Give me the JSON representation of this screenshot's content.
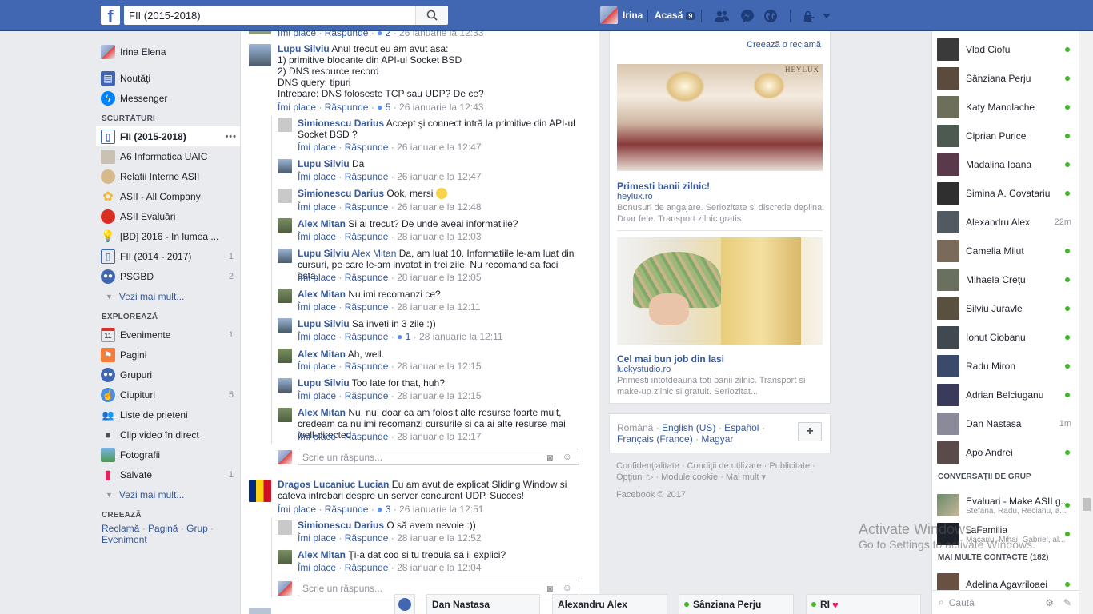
{
  "topbar": {
    "logo": "f",
    "search_value": "FII (2015-2018)",
    "user_name": "Irina",
    "home_label": "Acasă",
    "home_count": "9"
  },
  "left_nav": {
    "profile": "Irina Elena",
    "news": "Noutăţi",
    "messenger": "Messenger",
    "shortcuts_title": "SCURTĂTURI",
    "shortcuts": [
      {
        "label": "FII (2015-2018)",
        "count": ""
      },
      {
        "label": "A6 Informatica UAIC",
        "count": ""
      },
      {
        "label": "Relatii Interne ASII",
        "count": ""
      },
      {
        "label": "ASII - All Company",
        "count": ""
      },
      {
        "label": "ASII Evaluări",
        "count": ""
      },
      {
        "label": "[BD] 2016 - In lumea ...",
        "count": ""
      },
      {
        "label": "FII (2014 - 2017)",
        "count": "1"
      },
      {
        "label": "PSGBD",
        "count": "2"
      }
    ],
    "see_more": "Vezi mai mult...",
    "explore_title": "EXPLOREAZĂ",
    "explore": [
      {
        "label": "Evenimente",
        "count": "1"
      },
      {
        "label": "Pagini",
        "count": ""
      },
      {
        "label": "Grupuri",
        "count": ""
      },
      {
        "label": "Ciupituri",
        "count": "5"
      },
      {
        "label": "Liste de prieteni",
        "count": ""
      },
      {
        "label": "Clip video în direct",
        "count": ""
      },
      {
        "label": "Fotografii",
        "count": ""
      },
      {
        "label": "Salvate",
        "count": "1"
      }
    ],
    "see_more2": "Vezi mai mult...",
    "create_title": "CREEAZĂ",
    "create_links": [
      "Reclamă",
      "Pagină",
      "Grup",
      "Eveniment"
    ],
    "event_day": "11"
  },
  "feed": {
    "like": "Îmi place",
    "reply": "Răspunde",
    "reply_placeholder": "Scrie un răspuns...",
    "top_meta": {
      "count": "2",
      "time": "26 ianuarie la 12:33"
    },
    "comments": [
      {
        "name": "Lupu Silviu",
        "text": "Anul trecut eu am avut asa:\n1) primitive blocante din API-ul Socket BSD\n2) DNS resource record\nDNS query: tipuri\nIntrebare: DNS foloseste TCP sau UDP? De ce?",
        "count": "5",
        "time": "26 ianuarie la 12:43"
      },
      {
        "name": "Simionescu Darius",
        "text": "Accept şi connect intră la primitive din API-ul Socket BSD ?",
        "count": "",
        "time": "26 ianuarie la 12:47"
      },
      {
        "name": "Lupu Silviu",
        "text": "Da",
        "count": "",
        "time": "26 ianuarie la 12:47"
      },
      {
        "name": "Simionescu Darius",
        "text": "Ook, mersi",
        "count": "",
        "time": "26 ianuarie la 12:48"
      },
      {
        "name": "Alex Mitan",
        "text": "Si ai trecut? De unde aveai informatiile?",
        "count": "",
        "time": "28 ianuarie la 12:03"
      },
      {
        "name": "Lupu Silviu",
        "mention": "Alex Mitan",
        "text": "Da, am luat 10. Informatiile le-am luat din cursuri, pe care le-am invatat in trei zile. Nu recomand sa faci asta.",
        "count": "",
        "time": "28 ianuarie la 12:05"
      },
      {
        "name": "Alex Mitan",
        "text": "Nu imi recomanzi ce?",
        "count": "",
        "time": "28 ianuarie la 12:11"
      },
      {
        "name": "Lupu Silviu",
        "text": "Sa inveti in 3 zile :))",
        "count": "1",
        "time": "28 ianuarie la 12:11"
      },
      {
        "name": "Alex Mitan",
        "text": "Ah, well.",
        "count": "",
        "time": "28 ianuarie la 12:15"
      },
      {
        "name": "Lupu Silviu",
        "text": "Too late for that, huh?",
        "count": "",
        "time": "28 ianuarie la 12:15"
      },
      {
        "name": "Alex Mitan",
        "text": "Nu, nu, doar ca am folosit alte resurse foarte mult, credeam ca nu imi recomanzi cursurile si ca ai alte resurse mai well-directed",
        "count": "",
        "time": "28 ianuarie la 12:17"
      },
      {
        "name": "Dragos Lucaniuc Lucian",
        "text": "Eu am avut de explicat Sliding Window si cateva intrebari despre un server concurent UDP. Succes!",
        "count": "3",
        "time": "26 ianuarie la 12:51"
      },
      {
        "name": "Simionescu Darius",
        "text": "O să avem nevoie :))",
        "count": "",
        "time": "28 ianuarie la 12:52"
      },
      {
        "name": "Alex Mitan",
        "text": "Ţi-a dat cod si tu trebuia sa il explici?",
        "count": "",
        "time": "28 ianuarie la 12:04"
      }
    ]
  },
  "ads": {
    "create_ad": "Creează o reclamă",
    "ad1": {
      "brand": "HEYLUX",
      "title": "Primesti banii zilnic!",
      "domain": "heylux.ro",
      "text": "Bonusuri de angajare. Seriozitate si discretie deplina. Doar fete. Transport zilnic gratis"
    },
    "ad2": {
      "title": "Cel mai bun job din lasi",
      "domain": "luckystudio.ro",
      "text": "Primesti intotdeauna toti banii zilnic. Transport si make-up zilnic si gratuit. Seriozitat..."
    }
  },
  "languages": {
    "current": "Română",
    "others": [
      "English (US)",
      "Español",
      "Français (France)",
      "Magyar"
    ],
    "add": "+"
  },
  "footer": {
    "links": [
      "Confidenţialitate",
      "Condiţii de utilizare",
      "Publicitate",
      "Opţiuni",
      "Module cookie",
      "Mai mult"
    ],
    "copyright": "Facebook © 2017"
  },
  "chat": {
    "contacts": [
      {
        "name": "Vlad Ciofu",
        "status": "",
        "color": "#3a3a3a"
      },
      {
        "name": "Sânziana Perju",
        "status": "",
        "color": "#5b4a3e"
      },
      {
        "name": "Katy Manolache",
        "status": "",
        "color": "#6d6f5b"
      },
      {
        "name": "Ciprian Purice",
        "status": "",
        "color": "#4d5a52"
      },
      {
        "name": "Madalina Ioana",
        "status": "",
        "color": "#5a3a4a"
      },
      {
        "name": "Simina A. Covatariu",
        "status": "",
        "color": "#2f2f2f"
      },
      {
        "name": "Alexandru Alex",
        "status": "22m",
        "color": "#505a60"
      },
      {
        "name": "Camelia Milut",
        "status": "",
        "color": "#7a6a5a"
      },
      {
        "name": "Mihaela Creţu",
        "status": "",
        "color": "#6a7060"
      },
      {
        "name": "Silviu Juravle",
        "status": "",
        "color": "#5a5040"
      },
      {
        "name": "Ionut Ciobanu",
        "status": "",
        "color": "#404850"
      },
      {
        "name": "Radu Miron",
        "status": "",
        "color": "#3a4a6a"
      },
      {
        "name": "Adrian Belciuganu",
        "status": "",
        "color": "#3a3a5a"
      },
      {
        "name": "Dan Nastasa",
        "status": "1m",
        "color": "#8a8a9a"
      },
      {
        "name": "Apo Andrei",
        "status": "",
        "color": "#5a4a4a"
      }
    ],
    "groups_title": "CONVERSAŢII DE GRUP",
    "groups": [
      {
        "name": "Evaluari - Make ASII g...",
        "members": "Stefana, Radu, Recianu, a..."
      },
      {
        "name": "LaFamilia",
        "members": "Macariu, Mihai, Gabriel, al..."
      }
    ],
    "more_contacts": "MAI MULTE CONTACTE (182)",
    "last_contact": "Adelina Agavriloaei",
    "search_placeholder": "Caută"
  },
  "dock": {
    "tabs": [
      "Dan Nastasa",
      "Alexandru Alex",
      "Sânziana Perju",
      "RI"
    ]
  },
  "watermark": {
    "line1": "Activate Windows",
    "line2": "Go to Settings to activate Windows."
  },
  "colors": {
    "brand": "#4267b2",
    "link": "#365899",
    "online": "#42b72a"
  }
}
